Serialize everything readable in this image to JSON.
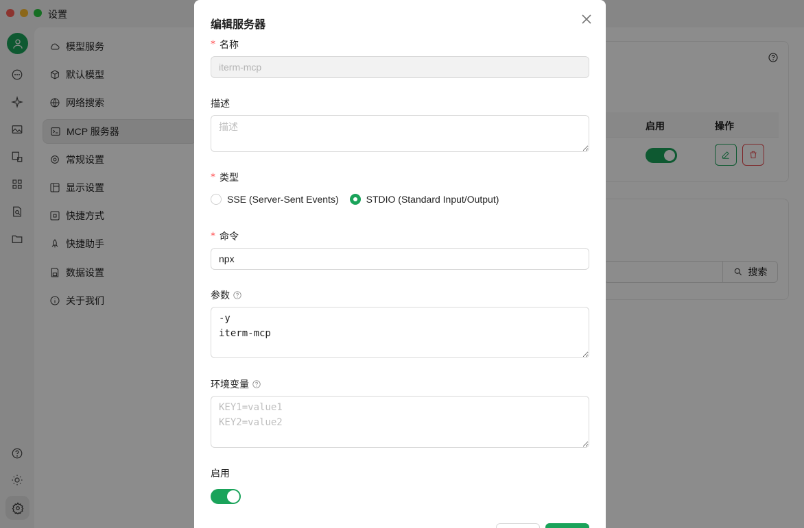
{
  "window": {
    "title": "设置"
  },
  "settings_nav": [
    {
      "label": "模型服务",
      "icon": "cloud-icon"
    },
    {
      "label": "默认模型",
      "icon": "cube-icon"
    },
    {
      "label": "网络搜索",
      "icon": "globe-icon"
    },
    {
      "label": "MCP 服务器",
      "icon": "terminal-icon",
      "active": true
    },
    {
      "label": "常规设置",
      "icon": "gear-icon"
    },
    {
      "label": "显示设置",
      "icon": "layout-icon"
    },
    {
      "label": "快捷方式",
      "icon": "command-icon"
    },
    {
      "label": "快捷助手",
      "icon": "rocket-icon"
    },
    {
      "label": "数据设置",
      "icon": "save-icon"
    },
    {
      "label": "关于我们",
      "icon": "info-icon"
    }
  ],
  "background": {
    "table_headers": {
      "enabled": "启用",
      "actions": "操作"
    },
    "search_button": "搜索"
  },
  "modal": {
    "title": "编辑服务器",
    "name": {
      "label": "名称",
      "value": "iterm-mcp",
      "required": true
    },
    "description": {
      "label": "描述",
      "placeholder": "描述"
    },
    "type": {
      "label": "类型",
      "required": true,
      "options": [
        {
          "label": "SSE (Server-Sent Events)",
          "checked": false
        },
        {
          "label": "STDIO (Standard Input/Output)",
          "checked": true
        }
      ]
    },
    "command": {
      "label": "命令",
      "value": "npx",
      "required": true
    },
    "args": {
      "label": "参数",
      "value": "-y\niterm-mcp"
    },
    "env": {
      "label": "环境变量",
      "placeholder": "KEY1=value1\nKEY2=value2"
    },
    "enabled": {
      "label": "启用",
      "value": true
    }
  },
  "colors": {
    "accent": "#1aa35a",
    "danger": "#e5484d",
    "required": "#ff4d4f"
  }
}
